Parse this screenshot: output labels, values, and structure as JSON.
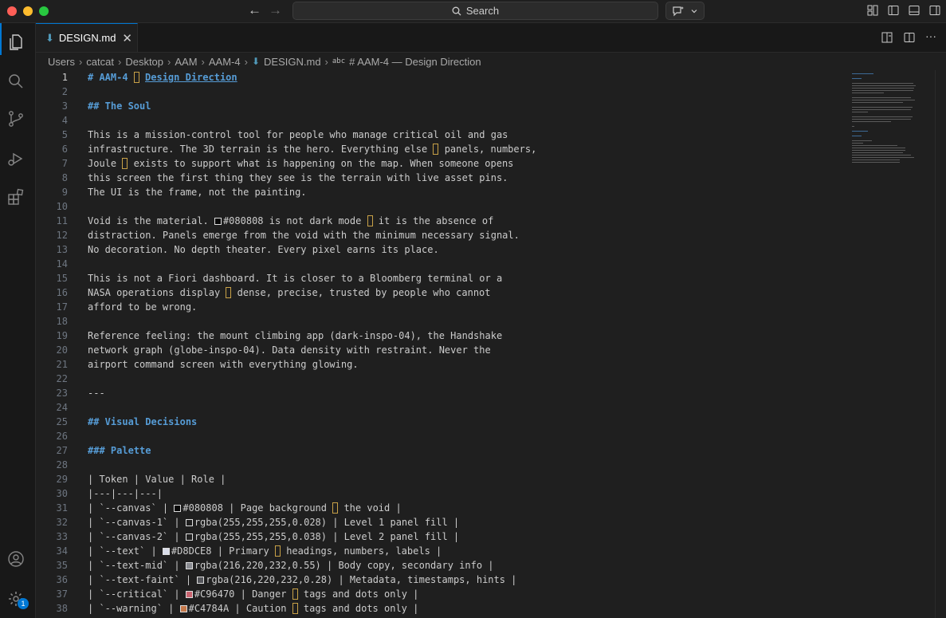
{
  "titlebar": {
    "search_label": "Search"
  },
  "tab": {
    "name": "DESIGN.md",
    "close": "✕"
  },
  "breadcrumb": [
    "Users",
    "catcat",
    "Desktop",
    "AAM",
    "AAM-4",
    "DESIGN.md"
  ],
  "breadcrumb_symbol": {
    "abc": "abc",
    "label": "# AAM-4 — Design Direction"
  },
  "badge_count": "1",
  "editor": {
    "current_line": 1,
    "lines": [
      {
        "n": "1",
        "t": "# AAM-4 — Design Direction",
        "k": "h1"
      },
      {
        "n": "2",
        "t": ""
      },
      {
        "n": "3",
        "t": "## The Soul",
        "k": "hdr"
      },
      {
        "n": "4",
        "t": ""
      },
      {
        "n": "5",
        "t": "This is a mission-control tool for people who manage critical oil and gas"
      },
      {
        "n": "6",
        "t": "infrastructure. The 3D terrain is the hero. Everything else — panels, numbers,"
      },
      {
        "n": "7",
        "t": "Joule — exists to support what is happening on the map. When someone opens"
      },
      {
        "n": "8",
        "t": "this screen the first thing they see is the terrain with live asset pins."
      },
      {
        "n": "9",
        "t": "The UI is the frame, not the painting."
      },
      {
        "n": "10",
        "t": ""
      },
      {
        "n": "11",
        "t": "Void is the material. □#080808 is not dark mode — it is the absence of",
        "sw": "#080808"
      },
      {
        "n": "12",
        "t": "distraction. Panels emerge from the void with the minimum necessary signal."
      },
      {
        "n": "13",
        "t": "No decoration. No depth theater. Every pixel earns its place."
      },
      {
        "n": "14",
        "t": ""
      },
      {
        "n": "15",
        "t": "This is not a Fiori dashboard. It is closer to a Bloomberg terminal or a"
      },
      {
        "n": "16",
        "t": "NASA operations display — dense, precise, trusted by people who cannot"
      },
      {
        "n": "17",
        "t": "afford to be wrong."
      },
      {
        "n": "18",
        "t": ""
      },
      {
        "n": "19",
        "t": "Reference feeling: the mount climbing app (dark-inspo-04), the Handshake"
      },
      {
        "n": "20",
        "t": "network graph (globe-inspo-04). Data density with restraint. Never the"
      },
      {
        "n": "21",
        "t": "airport command screen with everything glowing."
      },
      {
        "n": "22",
        "t": ""
      },
      {
        "n": "23",
        "t": "---"
      },
      {
        "n": "24",
        "t": ""
      },
      {
        "n": "25",
        "t": "## Visual Decisions",
        "k": "hdr"
      },
      {
        "n": "26",
        "t": ""
      },
      {
        "n": "27",
        "t": "### Palette",
        "k": "hdr"
      },
      {
        "n": "28",
        "t": ""
      },
      {
        "n": "29",
        "t": "| Token | Value | Role |"
      },
      {
        "n": "30",
        "t": "|---|---|---|"
      },
      {
        "n": "31",
        "t": "| `--canvas` | □#080808 | Page background — the void |",
        "sw": "#080808"
      },
      {
        "n": "32",
        "t": "| `--canvas-1` | □rgba(255,255,255,0.028) | Level 1 panel fill |",
        "sw": "#1f1f1f"
      },
      {
        "n": "33",
        "t": "| `--canvas-2` | □rgba(255,255,255,0.038) | Level 2 panel fill |",
        "sw": "#222222"
      },
      {
        "n": "34",
        "t": "| `--text` | □#D8DCE8 | Primary — headings, numbers, labels |",
        "sw": "#D8DCE8"
      },
      {
        "n": "35",
        "t": "| `--text-mid` | □rgba(216,220,232,0.55) | Body copy, secondary info |",
        "sw": "#8a8c92"
      },
      {
        "n": "36",
        "t": "| `--text-faint` | □rgba(216,220,232,0.28) | Metadata, timestamps, hints |",
        "sw": "#55565b"
      },
      {
        "n": "37",
        "t": "| `--critical` | □#C96470 | Danger — tags and dots only |",
        "sw": "#C96470"
      },
      {
        "n": "38",
        "t": "| `--warning` | □#C4784A | Caution — tags and dots only |",
        "sw": "#C4784A"
      }
    ]
  },
  "colors": {
    "accent": "#0078d4",
    "heading": "#569cd6",
    "editor_bg": "#1f1f1f",
    "sidebar_bg": "#181818"
  }
}
